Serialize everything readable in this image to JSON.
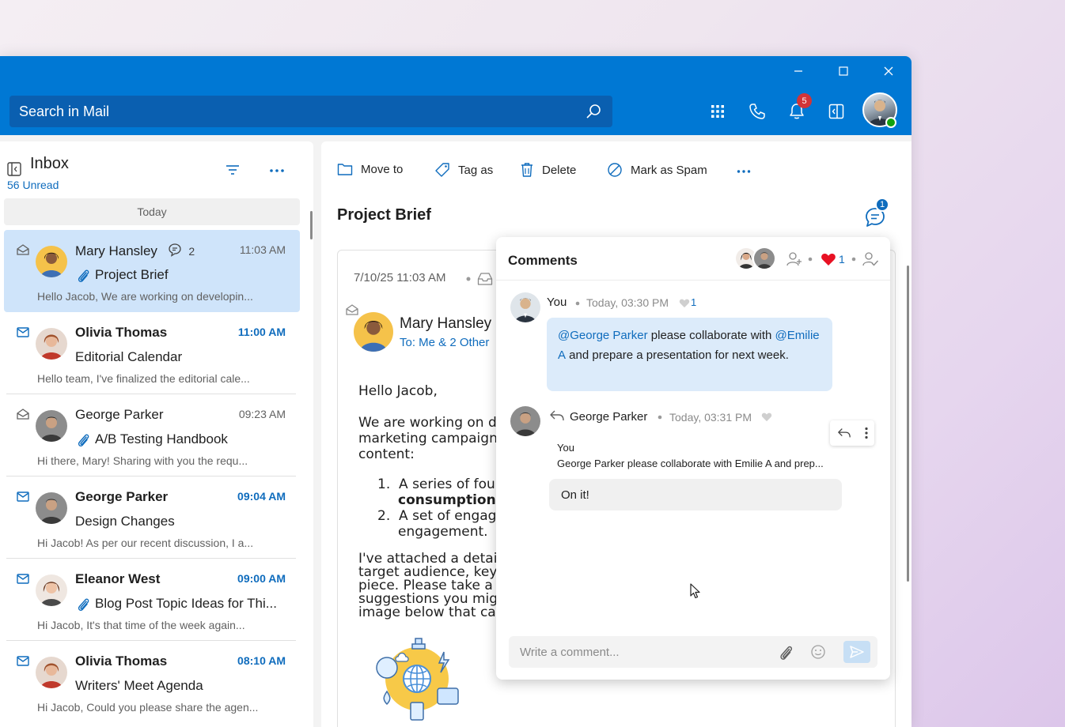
{
  "header": {
    "search_placeholder": "Search in Mail",
    "notification_count": "5"
  },
  "inbox": {
    "title": "Inbox",
    "unread": "56 Unread",
    "group_label": "Today",
    "messages": [
      {
        "from": "Mary Hansley",
        "chat_count": "2",
        "time": "11:03 AM",
        "subject": "Project Brief",
        "preview": "Hello Jacob, We are working on developin...",
        "unread": false,
        "attachment": true,
        "selected": true
      },
      {
        "from": "Olivia Thomas",
        "time": "11:00 AM",
        "subject": "Editorial Calendar",
        "preview": "Hello team, I've finalized the editorial cale...",
        "unread": true,
        "attachment": false
      },
      {
        "from": "George Parker",
        "time": "09:23 AM",
        "subject": "A/B Testing Handbook",
        "preview": "Hi there, Mary! Sharing with you the requ...",
        "unread": false,
        "attachment": true
      },
      {
        "from": "George Parker",
        "time": "09:04 AM",
        "subject": "Design Changes",
        "preview": "Hi Jacob! As per our recent discussion, I a...",
        "unread": true,
        "attachment": false
      },
      {
        "from": "Eleanor West",
        "time": "09:00 AM",
        "subject": "Blog Post Topic Ideas for Thi...",
        "preview": "Hi Jacob, It's that time of the week again...",
        "unread": true,
        "attachment": true
      },
      {
        "from": "Olivia Thomas",
        "time": "08:10 AM",
        "subject": "Writers' Meet Agenda",
        "preview": "Hi Jacob, Could you please share the agen...",
        "unread": true,
        "attachment": false
      }
    ]
  },
  "toolbar": {
    "move_to": "Move to",
    "tag_as": "Tag as",
    "delete": "Delete",
    "mark_spam": "Mark as Spam"
  },
  "message": {
    "subject": "Project Brief",
    "comment_count": "1",
    "date": "7/10/25 11:03 AM",
    "from": "Mary Hansley",
    "to": "To: Me & 2 Other",
    "greeting": "Hello Jacob,",
    "para1": [
      "We are working on d",
      "marketing campaign",
      "content:"
    ],
    "list1_a": "A series of four",
    "list1_b": "consumption",
    "list2_a": "A set of engag",
    "list2_b": "engagement.",
    "para2": [
      "I've attached a detai",
      "target audience, key",
      "piece. Please take a",
      "suggestions you mig",
      "image below that cap"
    ]
  },
  "comments": {
    "title": "Comments",
    "reaction_count": "1",
    "items": [
      {
        "author": "You",
        "time": "Today, 03:30 PM",
        "likes": "1",
        "mention1": "@George Parker",
        "text1": " please collaborate with ",
        "mention2": "@Emilie A",
        "text2": " and prepare a presentation for next week."
      },
      {
        "author": "George Parker",
        "time": "Today, 03:31 PM",
        "quote_author": "You",
        "quote_text": "George Parker please collaborate with Emilie A and prep...",
        "text": "On it!"
      }
    ],
    "composer_placeholder": "Write a comment..."
  },
  "colors": {
    "accent": "#0078d4",
    "link": "#0f6cbd",
    "selected_row": "#cfe4fa",
    "badge": "#d13438"
  }
}
